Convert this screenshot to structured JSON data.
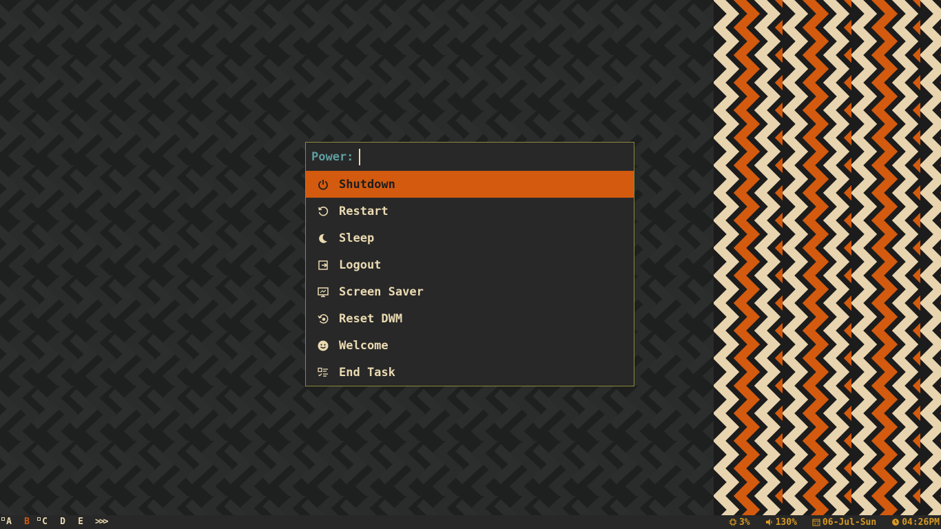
{
  "menu": {
    "prompt": "Power:",
    "items": [
      {
        "label": "Shutdown",
        "icon": "power-icon",
        "selected": true
      },
      {
        "label": "Restart",
        "icon": "restart-icon"
      },
      {
        "label": "Sleep",
        "icon": "moon-icon"
      },
      {
        "label": "Logout",
        "icon": "logout-icon"
      },
      {
        "label": "Screen Saver",
        "icon": "monitor-icon"
      },
      {
        "label": "Reset DWM",
        "icon": "reset-icon"
      },
      {
        "label": "Welcome",
        "icon": "smiley-icon"
      },
      {
        "label": "End Task",
        "icon": "task-list-icon"
      }
    ]
  },
  "bar": {
    "tags": [
      "A",
      "B",
      "C",
      "D",
      "E"
    ],
    "active_tag": "B",
    "layout_symbol": ">>>",
    "cpu": "3%",
    "volume": "130%",
    "date": "06-Jul-Sun",
    "time": "04:26PM"
  },
  "colors": {
    "accent": "#d35a0e",
    "cream": "#e8d5b0",
    "menu_bg": "#282828",
    "border": "#8d8a3a",
    "prompt": "#5f9ea0",
    "status": "#d79921"
  }
}
